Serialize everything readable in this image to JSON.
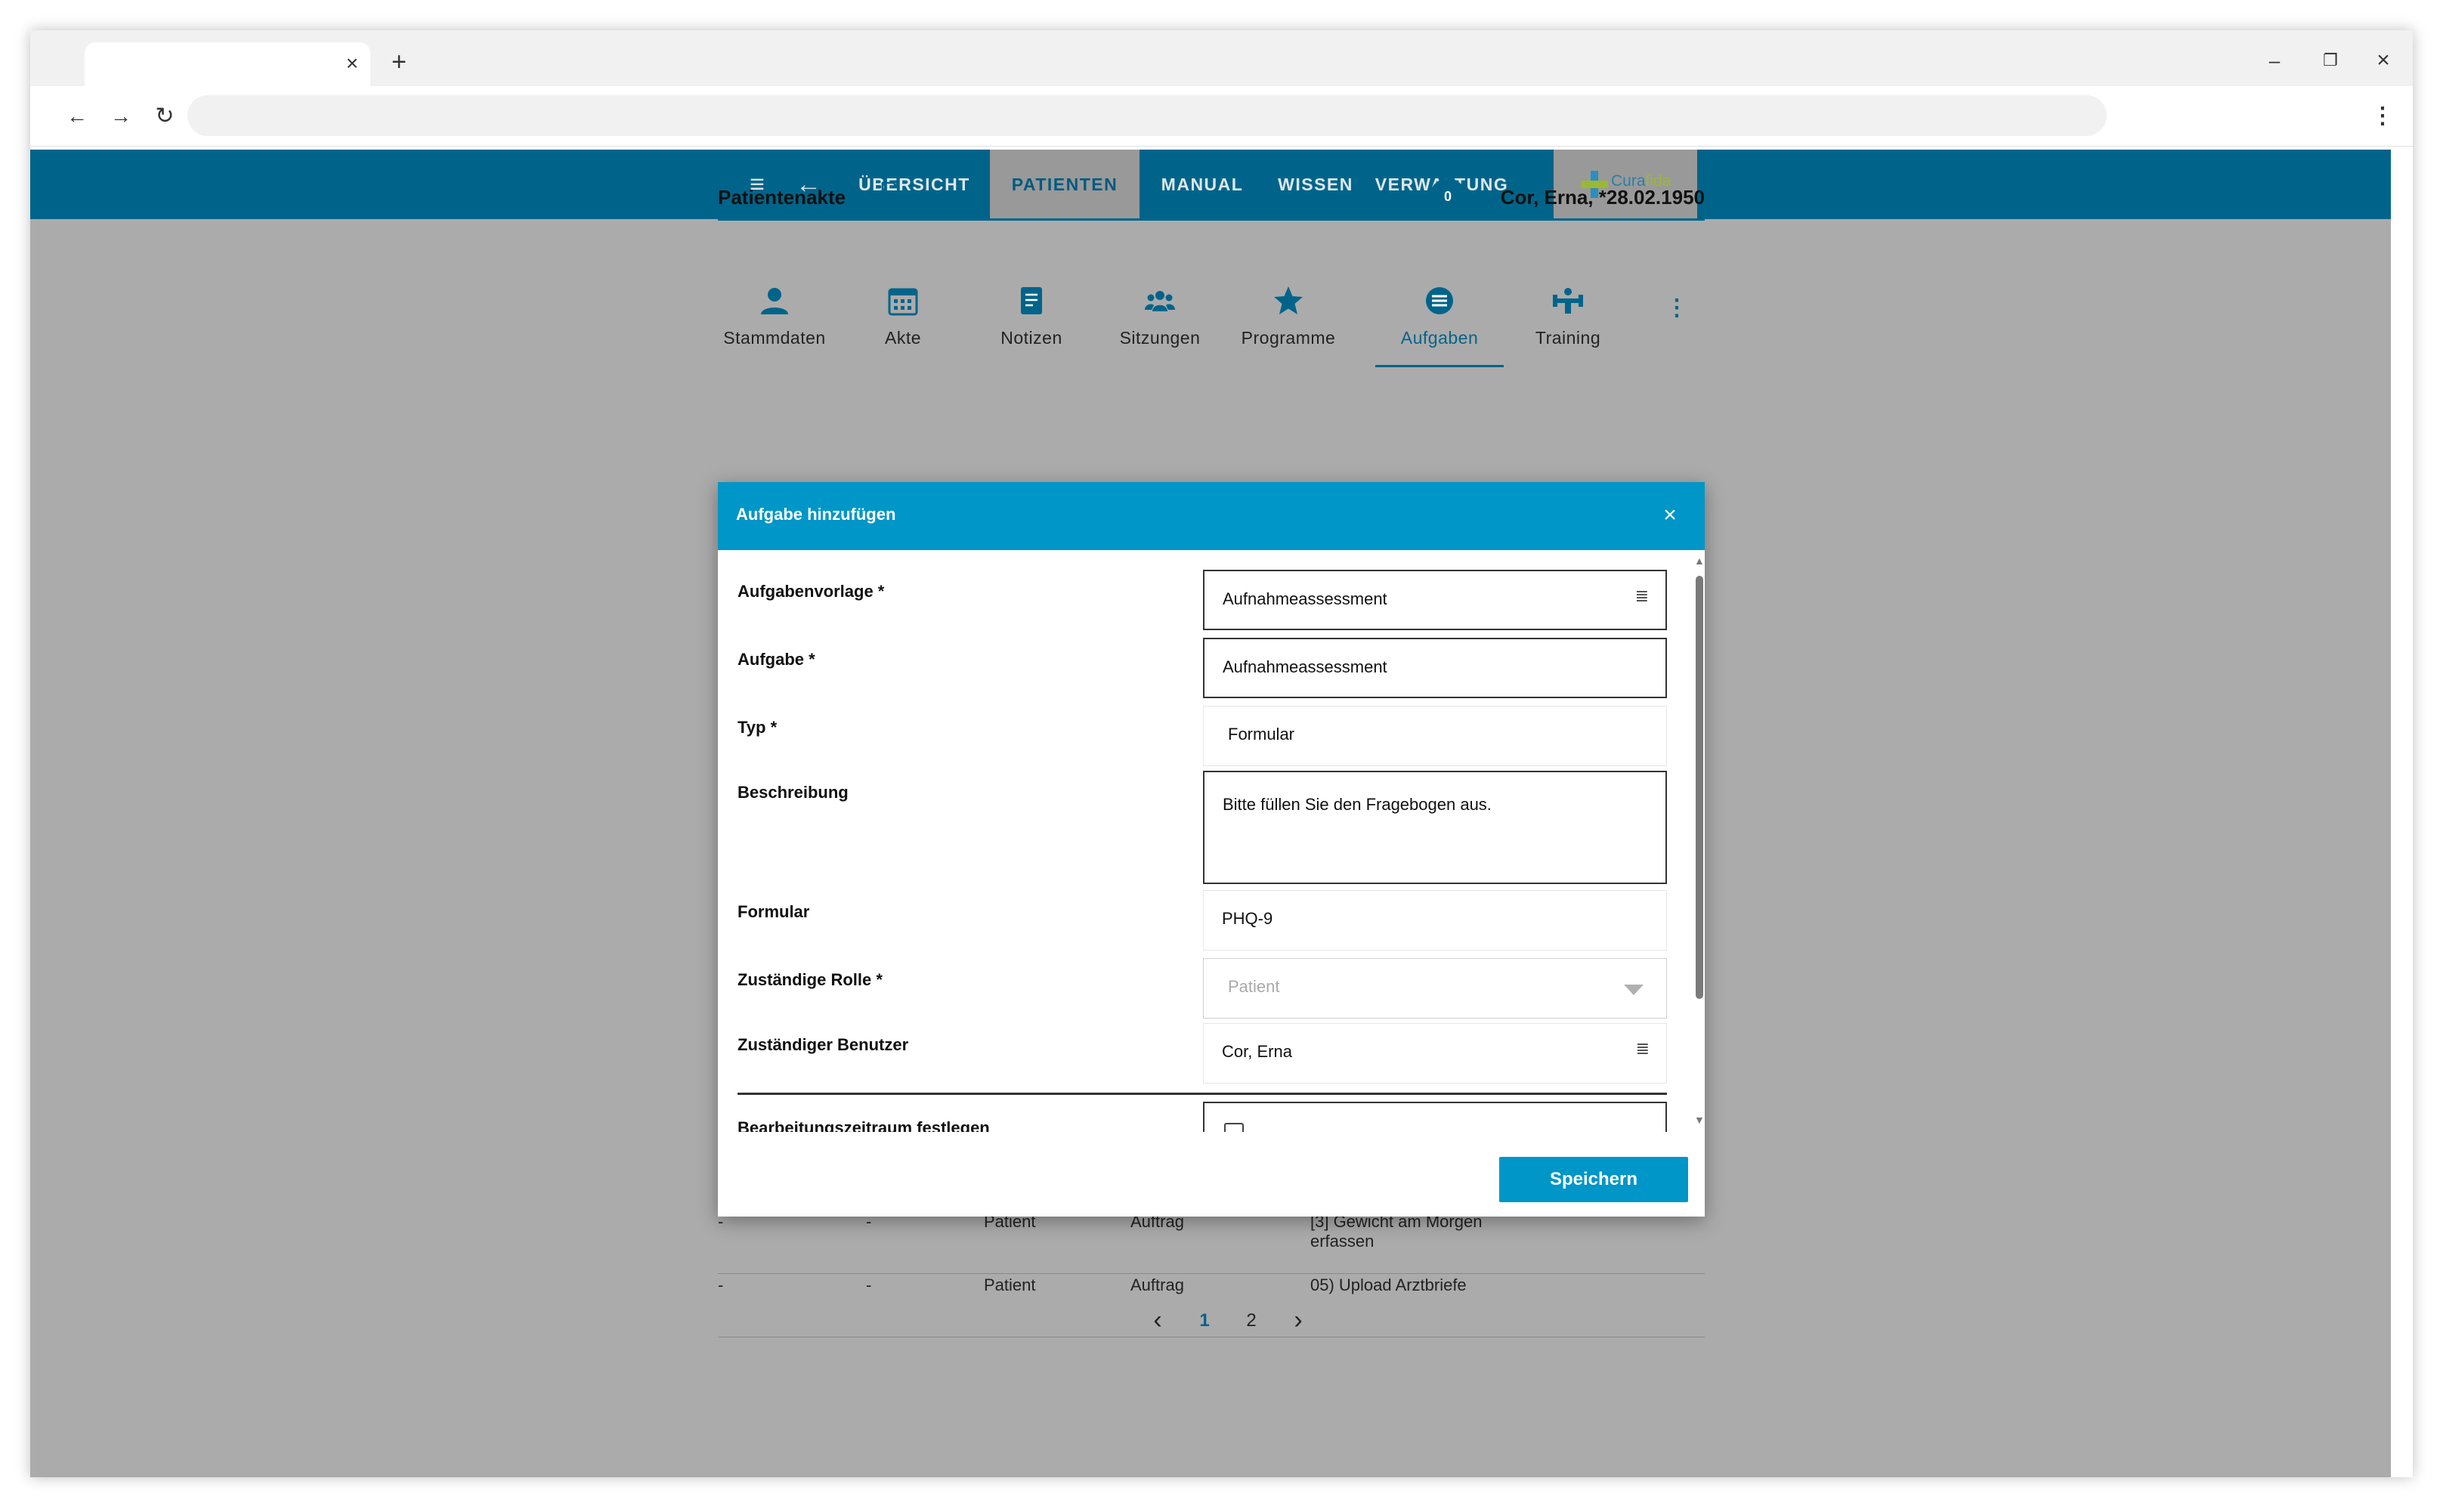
{
  "browser": {
    "tab_close": "×",
    "tab_new": "+",
    "minimize": "–",
    "restore": "❐",
    "close": "×",
    "back": "←",
    "forward": "→",
    "reload": "↻",
    "menu": "⋮"
  },
  "topnav": {
    "menu_icon": "≡",
    "back_icon": "←",
    "items": [
      "ÜBERSICHT",
      "PATIENTEN",
      "MANUAL",
      "WISSEN",
      "VERWALTUNG"
    ],
    "active": "PATIENTEN",
    "logo_text_a": "Cura",
    "logo_text_b": "fida"
  },
  "record": {
    "title": "Patientenakte",
    "badge_count": "0",
    "patient": "Cor, Erna, *28.02.1950"
  },
  "record_tabs": [
    {
      "label": "Stammdaten",
      "icon": "person-icon"
    },
    {
      "label": "Akte",
      "icon": "calendar-icon"
    },
    {
      "label": "Notizen",
      "icon": "note-icon"
    },
    {
      "label": "Sitzungen",
      "icon": "group-icon"
    },
    {
      "label": "Programme",
      "icon": "star-icon"
    },
    {
      "label": "Aufgaben",
      "icon": "list-icon",
      "active": true
    },
    {
      "label": "Training",
      "icon": "fitness-icon"
    }
  ],
  "more_icon": "⋮",
  "background_rows": [
    {
      "c1": "-",
      "c2": "-",
      "c3": "Patient",
      "c4": "Auftrag",
      "c5a": "[3] Gewicht am Morgen",
      "c5b": "erfassen"
    },
    {
      "c1": "-",
      "c2": "-",
      "c3": "Patient",
      "c4": "Auftrag",
      "c5a": "05) Upload Arztbriefe",
      "c5b": ""
    }
  ],
  "pagination": {
    "prev": "‹",
    "pages": [
      "1",
      "2"
    ],
    "current": "1",
    "next": "›"
  },
  "modal": {
    "title": "Aufgabe hinzufügen",
    "close_icon": "×",
    "fields": {
      "vorlage_label": "Aufgabenvorlage *",
      "vorlage_value": "Aufnahmeassessment",
      "aufgabe_label": "Aufgabe *",
      "aufgabe_value": "Aufnahmeassessment",
      "typ_label": "Typ *",
      "typ_value": "Formular",
      "beschreibung_label": "Beschreibung",
      "beschreibung_value": "Bitte füllen Sie den Fragebogen aus.",
      "formular_label": "Formular",
      "formular_value": "PHQ-9",
      "rolle_label": "Zuständige Rolle *",
      "rolle_placeholder": "Patient",
      "benutzer_label": "Zuständiger Benutzer",
      "benutzer_value": "Cor, Erna",
      "zeitraum_label": "Bearbeitungszeitraum festlegen"
    },
    "list_icon": "≣",
    "save_label": "Speichern"
  },
  "colors": {
    "app_bar": "#00648a",
    "modal_header": "#0096c8",
    "overlay_bg": "#ababab"
  }
}
